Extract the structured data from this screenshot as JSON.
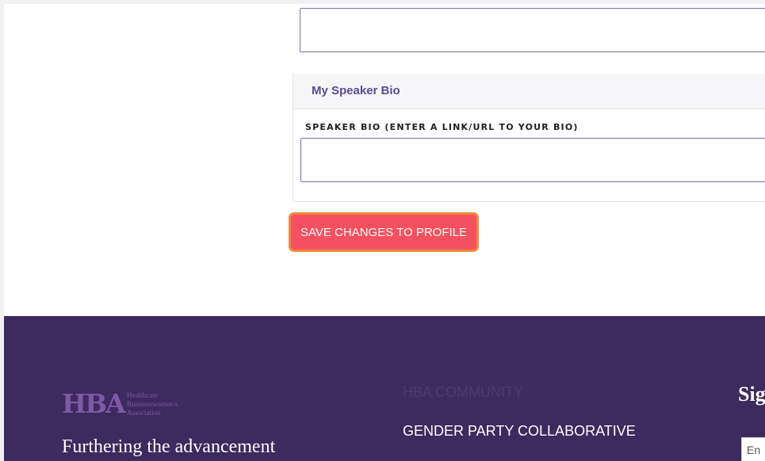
{
  "bio_section": {
    "title": "My Speaker Bio",
    "field_label": "SPEAKER BIO (ENTER A LINK/URL TO YOUR BIO)",
    "field_value": ""
  },
  "actions": {
    "save_label": "SAVE CHANGES TO PROFILE"
  },
  "footer": {
    "logo_mark": "HBA",
    "logo_lines": [
      "Healthcare",
      "Businesswomen's",
      "Association"
    ],
    "tagline": "Furthering the advancement",
    "menu_items": [
      "HBA COMMUNITY",
      "GENDER PARTY COLLABORATIVE"
    ],
    "signup_heading": "Sig",
    "signup_placeholder": "En"
  },
  "colors": {
    "accent_purple": "#5b4b94",
    "footer_bg": "#3d2a5e",
    "button_bg": "#f5505f",
    "button_border": "#f0893a"
  }
}
